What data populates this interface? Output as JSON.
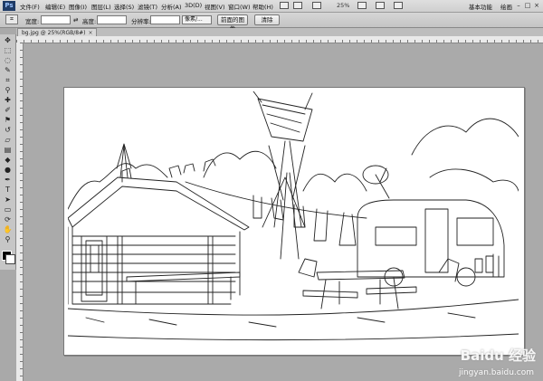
{
  "app": {
    "logo": "Ps"
  },
  "menu": [
    {
      "label": "文件(F)"
    },
    {
      "label": "编辑(E)"
    },
    {
      "label": "图像(I)"
    },
    {
      "label": "图层(L)"
    },
    {
      "label": "选择(S)"
    },
    {
      "label": "滤镜(T)"
    },
    {
      "label": "分析(A)"
    },
    {
      "label": "3D(D)"
    },
    {
      "label": "视图(V)"
    },
    {
      "label": "窗口(W)"
    },
    {
      "label": "帮助(H)"
    }
  ],
  "zoom": "25%",
  "workspace": {
    "essentials": "基本功能",
    "painting": "绘画"
  },
  "window_controls": {
    "minimize": "–",
    "restore": "□",
    "close": "×"
  },
  "options": {
    "width_label": "宽度:",
    "height_label": "高度:",
    "resolution_label": "分辨率:",
    "unit_select": "像素/...",
    "front_image_button": "前面的图像",
    "clear_button": "清除",
    "swap_icon": "⇄"
  },
  "document_tab": {
    "title": "bg.jpg @ 25%(RGB/8#)",
    "close": "×"
  },
  "watermark": {
    "brand": "Baidu 经验",
    "url": "jingyan.baidu.com"
  }
}
